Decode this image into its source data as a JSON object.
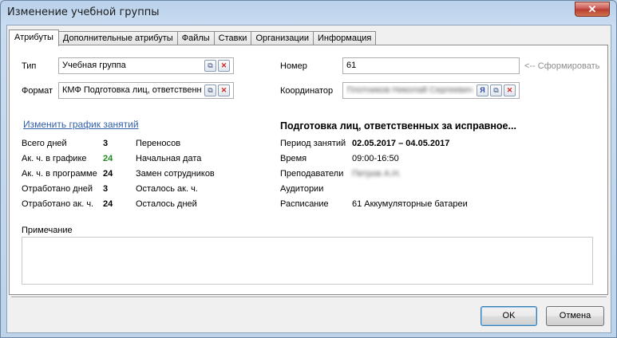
{
  "window": {
    "title": "Изменение учебной группы",
    "close": "✕"
  },
  "tabs": [
    "Атрибуты",
    "Дополнительные атрибуты",
    "Файлы",
    "Ставки",
    "Организации",
    "Информация"
  ],
  "form": {
    "type_label": "Тип",
    "type_value": "Учебная группа",
    "format_label": "Формат",
    "format_value": "КМФ Подготовка лиц, ответственн",
    "number_label": "Номер",
    "number_value": "61",
    "generate_link": "<-- Сформировать",
    "coordinator_label": "Координатор",
    "coordinator_value": "Плотников Николай Сергеевич"
  },
  "schedule_link": "Изменить график занятий",
  "stats_left": [
    {
      "label": "Всего дней",
      "value": "3"
    },
    {
      "label": "Ак. ч. в графике",
      "value": "24"
    },
    {
      "label": "Ак. ч. в программе",
      "value": "24"
    },
    {
      "label": "Отработано дней",
      "value": "3"
    },
    {
      "label": "Отработано ак. ч.",
      "value": "24"
    }
  ],
  "stats_mid": [
    "Переносов",
    "Начальная дата",
    "Замен сотрудников",
    "Осталось ак. ч.",
    "Осталось дней"
  ],
  "course": {
    "title": "Подготовка лиц, ответственных за исправное...",
    "period_label": "Период занятий",
    "period_value": "02.05.2017 – 04.05.2017",
    "time_label": "Время",
    "time_value": "09:00-16:50",
    "teachers_label": "Преподаватели",
    "teachers_value": "Петров А.Н.",
    "rooms_label": "Аудитории",
    "rooms_value": "",
    "schedule_label": "Расписание",
    "schedule_value": "61 Аккумуляторные батареи"
  },
  "note_label": "Примечание",
  "buttons": {
    "ok": "OK",
    "cancel": "Отмена"
  },
  "colors": {
    "link": "#3360a8",
    "highlight_value": "#1f8a1f",
    "close_button": "#c75050"
  }
}
